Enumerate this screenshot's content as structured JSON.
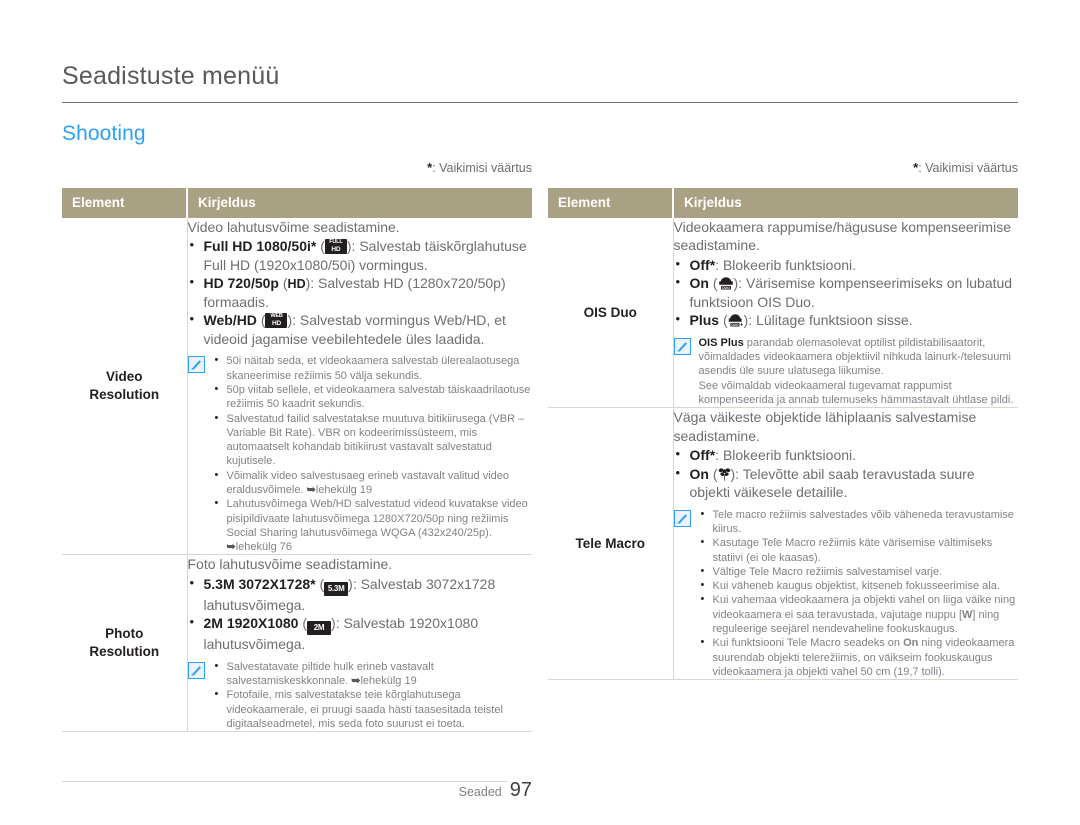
{
  "header": {
    "chapter_title": "Seadistuste menüü",
    "section_title": "Shooting"
  },
  "default_note": {
    "star": "*",
    "text": ": Vaikimisi väärtus"
  },
  "table_headers": {
    "element": "Element",
    "description": "Kirjeldus"
  },
  "left_table": {
    "rows": [
      {
        "element": "Video\nResolution",
        "element_line1": "Video",
        "element_line2": "Resolution",
        "lead": "Video lahutusvõime seadistamine.",
        "bullets": [
          {
            "label": "Full HD 1080/50i*",
            "icon": "full-hd-badge-icon",
            "icon_top": "FULL",
            "icon_bottom": "HD",
            "text": "): Salvestab täiskõrglahutuse Full HD (1920x1080/50i) vormingus."
          },
          {
            "label": "HD 720/50p",
            "icon": "hd-text-badge-icon",
            "icon_text": "HD",
            "text": "): Salvestab HD (1280x720/50p) formaadis."
          },
          {
            "label": "Web/HD",
            "icon": "web-hd-badge-icon",
            "icon_top": "WEB",
            "icon_bottom": "HD",
            "text": "): Salvestab vormingus Web/HD, et videoid jagamise veebilehtedele üles laadida."
          }
        ],
        "notes": [
          "50i näitab seda, et videokaamera salvestab ülerealaotusega skaneerimise režiimis 50 välja sekundis.",
          "50p viitab sellele, et videokaamera salvestab täiskaadrilaotuse režiimis 50 kaadrit sekundis.",
          "Salvestatud failid salvestatakse muutuva bitikiirusega (VBR – Variable Bit Rate). VBR on kodeerimissüsteem, mis automaatselt kohandab bitikiirust vastavalt salvestatud kujutisele.",
          "Võimalik video salvestusaeg erineb vastavalt valitud video eraldusvõimele. ➥lehekülg 19",
          "Lahutusvõimega Web/HD salvestatud videod kuvatakse video pisipildivaate lahutusvõimega 1280X720/50p ning režiimis Social Sharing lahutusvõimega WQGA (432x240/25p). ➥lehekülg 76"
        ]
      },
      {
        "element_line1": "Photo",
        "element_line2": "Resolution",
        "lead": "Foto lahutusvõime seadistamine.",
        "bullets": [
          {
            "label": "5.3M 3072X1728*",
            "icon": "five-three-mp-badge-icon",
            "icon_text": "5.3M",
            "text": "): Salvestab 3072x1728 lahutusvõimega."
          },
          {
            "label": "2M 1920X1080",
            "icon": "two-mp-badge-icon",
            "icon_text": "2M",
            "text": "): Salvestab 1920x1080 lahutusvõimega."
          }
        ],
        "notes": [
          "Salvestatavate piltide hulk erineb vastavalt salvestamiskeskkonnale. ➥lehekülg 19",
          "Fotofaile, mis salvestatakse teie kõrglahutusega videokaamerale, ei pruugi saada hästi taasesitada teistel digitaalseadmetel, mis seda foto suurust ei toeta."
        ]
      }
    ]
  },
  "right_table": {
    "rows": [
      {
        "element_line1": "OIS Duo",
        "element_line2": "",
        "lead": "Videokaamera rappumise/hägususe kompenseerimise seadistamine.",
        "bullets": [
          {
            "label": "Off*",
            "icon": null,
            "text": ": Blokeerib funktsiooni."
          },
          {
            "label": "On",
            "icon": "ois-duo-icon",
            "text": "): Värisemise kompenseerimiseks on lubatud funktsioon OIS Duo."
          },
          {
            "label": "Plus",
            "icon": "ois-duo-plus-icon",
            "text": "): Lülitage funktsioon sisse."
          }
        ],
        "note_prefix_bold": "OIS Plus",
        "note_paragraphs": [
          " parandab olemasolevat optilist pildistabilisaatorit, võimaldades videokaamera objektiivil nihkuda lainurk-/telesuumi asendis üle suure ulatusega liikumise.",
          "See võimaldab videokaameral tugevamat rappumist kompenseerida ja annab tulemuseks hämmastavalt ühtlase pildi."
        ]
      },
      {
        "element_line1": "Tele Macro",
        "element_line2": "",
        "lead": "Väga väikeste objektide lähiplaanis salvestamise seadistamine.",
        "bullets": [
          {
            "label": "Off*",
            "icon": null,
            "text": ": Blokeerib funktsiooni."
          },
          {
            "label": "On",
            "icon": "tele-macro-flower-icon",
            "text": "): Televõtte abil saab teravustada suure objekti väikesele detailile."
          }
        ],
        "notes": [
          "Tele macro režiimis salvestades võib väheneda teravustamise kiirus.",
          "Kasutage Tele Macro režiimis käte värisemise vältimiseks statiivi (ei ole kaasas).",
          "Vältige Tele Macro režiimis salvestamisel varje.",
          "Kui väheneb kaugus objektist, kitseneb fokusseerimise ala.",
          "Kui vahemaa videokaamera ja objekti vahel on liiga väike ning videokaamera ei saa teravustada, vajutage nuppu [W] ning reguleerige seejärel nendevaheline fookuskaugus.",
          "Kui funktsiooni Tele Macro seadeks on On ning videokaamera suurendab objekti telerežiimis, on väikseim fookuskaugus videokaamera ja objekti vahel 50 cm (19,7 tolli)."
        ],
        "note_w_key": "W",
        "note_on_bold": "On"
      }
    ]
  },
  "footer": {
    "label": "Seaded",
    "page_number": "97"
  },
  "colors": {
    "accent_blue": "#2e9ff2",
    "table_header_bg": "#a9a183",
    "body_text": "#6d6e71",
    "bold_text": "#231f20",
    "rule": "#d8d6cf"
  }
}
